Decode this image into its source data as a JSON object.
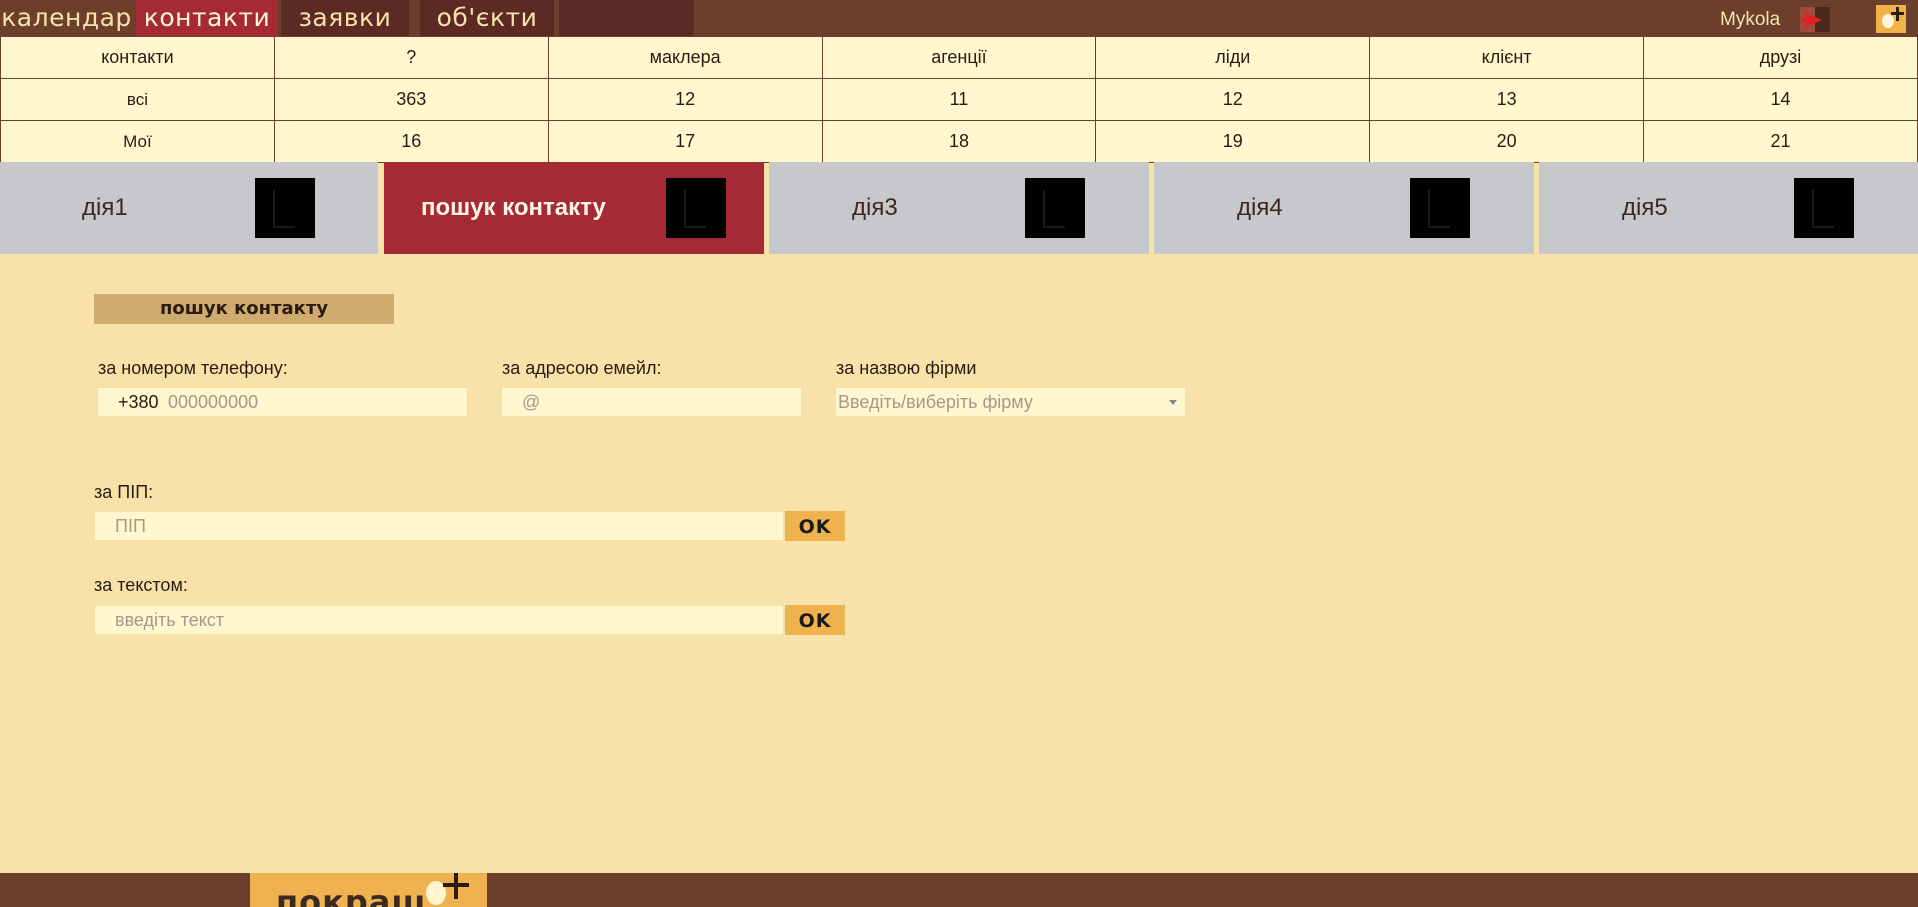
{
  "nav": {
    "tabs": [
      {
        "label": "календар"
      },
      {
        "label": "контакти"
      },
      {
        "label": "заявки"
      },
      {
        "label": "об'єкти"
      },
      {
        "label": ""
      }
    ],
    "active": "контакти",
    "username": "Mykola"
  },
  "stats": {
    "headers": [
      "контакти",
      "?",
      "маклера",
      "агенції",
      "ліди",
      "клієнт",
      "друзі"
    ],
    "rows": [
      {
        "label": "всі",
        "values": [
          "363",
          "12",
          "11",
          "12",
          "13",
          "14"
        ]
      },
      {
        "label": "Мої",
        "values": [
          "16",
          "17",
          "18",
          "19",
          "20",
          "21"
        ]
      }
    ]
  },
  "actions": [
    {
      "label": "дія1"
    },
    {
      "label": "пошук контакту",
      "active": true
    },
    {
      "label": "дія3"
    },
    {
      "label": "дія4"
    },
    {
      "label": "дія5"
    }
  ],
  "form": {
    "title": "пошук контакту",
    "phone": {
      "label": "за номером телефону:",
      "prefix": "+380",
      "placeholder": "000000000"
    },
    "email": {
      "label": "за адресою емейл:",
      "placeholder": "@"
    },
    "firm": {
      "label": "за назвою фірми",
      "placeholder": "Введіть/виберіть фірму"
    },
    "pip": {
      "label": "за ПІП:",
      "placeholder": "ПІП",
      "button": "OK"
    },
    "text": {
      "label": "за текстом:",
      "placeholder": "введіть текст",
      "button": "OK"
    }
  },
  "footer": {
    "improve_label": "покращ"
  },
  "colors": {
    "topbar": "#6b3f2c",
    "accent": "#a62a35",
    "background": "#f8e2a9",
    "button": "#f0b24e",
    "tile": "#c6c8cb"
  },
  "icons": [
    "logout-icon",
    "lightbulb-plus-icon"
  ]
}
